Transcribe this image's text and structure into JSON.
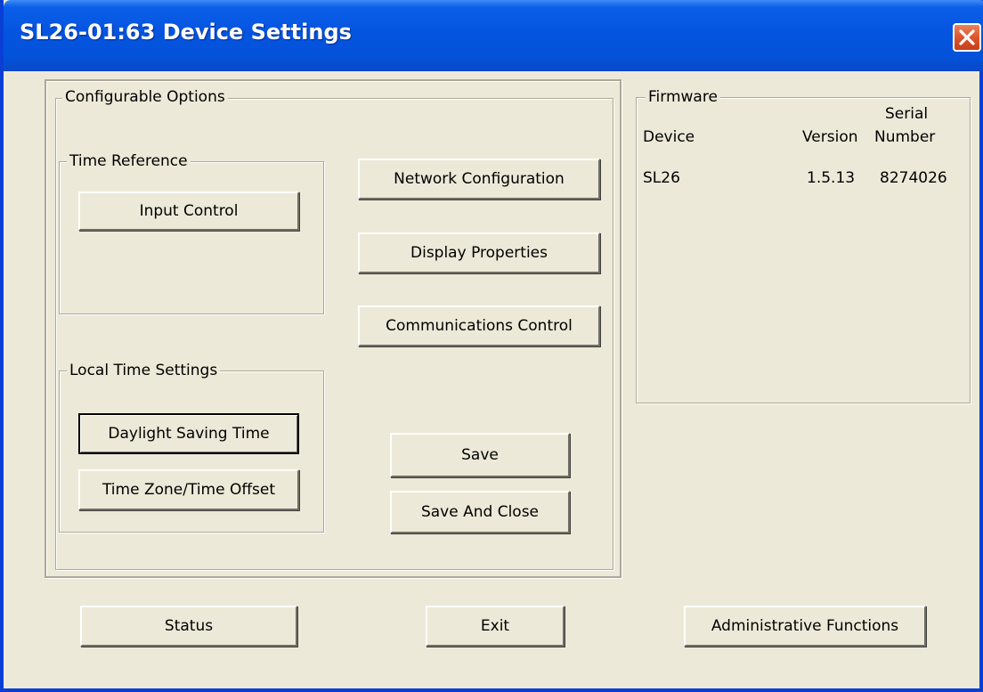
{
  "window": {
    "title": "SL26-01:63  Device Settings"
  },
  "configurable": {
    "label": "Configurable Options",
    "time_reference": {
      "label": "Time Reference",
      "input_control": "Input Control"
    },
    "local_time": {
      "label": "Local Time Settings",
      "daylight_saving": "Daylight Saving Time",
      "time_zone": "Time Zone/Time Offset"
    },
    "network_configuration": "Network Configuration",
    "display_properties": "Display Properties",
    "communications_control": "Communications Control",
    "save": "Save",
    "save_and_close": "Save And Close"
  },
  "firmware": {
    "label": "Firmware",
    "headers": {
      "device": "Device",
      "version": "Version",
      "serial_line1": "Serial",
      "serial_line2": "Number"
    },
    "rows": [
      {
        "device": "SL26",
        "version": "1.5.13",
        "serial": "8274026"
      }
    ]
  },
  "bottom": {
    "status": "Status",
    "exit": "Exit",
    "admin": "Administrative Functions"
  },
  "colors": {
    "title_blue": "#0554e0",
    "window_face": "#ece9d8",
    "close_red": "#d9522a"
  }
}
